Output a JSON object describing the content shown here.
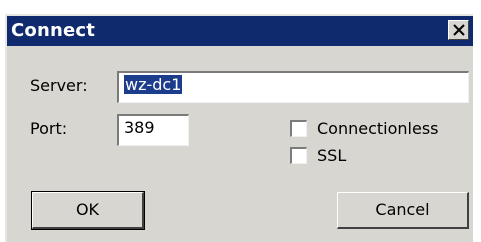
{
  "dialog": {
    "title": "Connect",
    "close_glyph": "✕"
  },
  "server": {
    "label": "Server:",
    "value": "wz-dc1"
  },
  "port": {
    "label": "Port:",
    "value": "389"
  },
  "options": {
    "connectionless_label": "Connectionless",
    "connectionless_checked": false,
    "ssl_label": "SSL",
    "ssl_checked": false
  },
  "buttons": {
    "ok_label": "OK",
    "cancel_label": "Cancel"
  }
}
